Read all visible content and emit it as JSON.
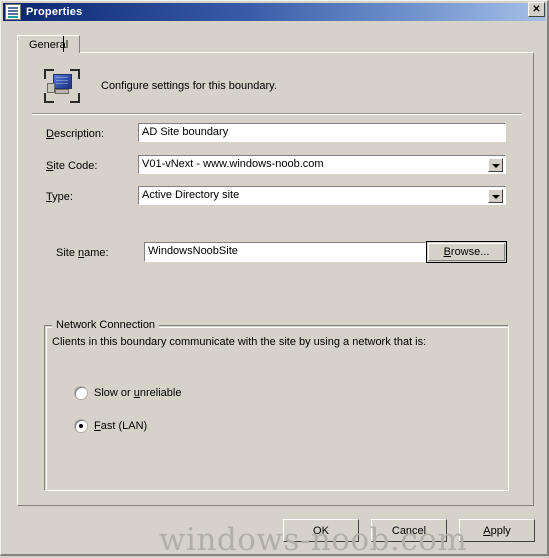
{
  "window": {
    "title": "Properties",
    "icon": "properties-document-icon",
    "close_label": "✕"
  },
  "tabs": [
    {
      "label": "General",
      "selected": true
    }
  ],
  "header": {
    "icon": "boundary-computer-icon",
    "text": "Configure settings for this boundary."
  },
  "fields": {
    "description": {
      "label_prefix": "",
      "label_accel": "D",
      "label_suffix": "escription:",
      "value": "AD Site boundary"
    },
    "site_code": {
      "label_prefix": "",
      "label_accel": "S",
      "label_suffix": "ite Code:",
      "value": "V01-vNext - www.windows-noob.com",
      "arrow_icon": "chevron-down-icon"
    },
    "type": {
      "label_prefix": "",
      "label_accel": "T",
      "label_suffix": "ype:",
      "value": "Active Directory site",
      "arrow_icon": "chevron-down-icon"
    },
    "site_name": {
      "label_prefix": "Site ",
      "label_accel": "n",
      "label_suffix": "ame:",
      "value": "WindowsNoobSite"
    }
  },
  "browse_button": {
    "prefix": "",
    "accel": "B",
    "suffix": "rowse..."
  },
  "network_group": {
    "title": "Network Connection",
    "description": "Clients in this boundary communicate with the site by using a network that is:",
    "options": [
      {
        "prefix": "Slow or ",
        "accel": "u",
        "suffix": "nreliable",
        "selected": false
      },
      {
        "prefix": "",
        "accel": "F",
        "suffix": "ast (LAN)",
        "selected": true
      }
    ]
  },
  "footer_buttons": {
    "ok": "OK",
    "cancel": "Cancel",
    "apply_prefix": "",
    "apply_accel": "A",
    "apply_suffix": "pply"
  },
  "watermark": "windows-noob.com",
  "colors": {
    "dialog_face": "#d6d2ca",
    "title_gradient_start": "#0a246a",
    "title_gradient_end": "#a6c0e8",
    "field_background": "#ffffff",
    "watermark": "#b2afa8"
  }
}
